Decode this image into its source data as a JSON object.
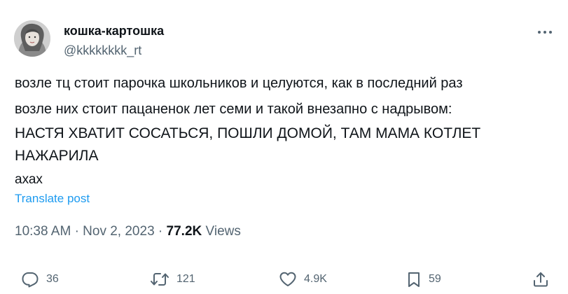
{
  "author": {
    "display_name": "кошка-картошка",
    "handle": "@kkkkkkkk_rt"
  },
  "post": {
    "lines": [
      "возле тц стоит парочка школьников и целуются, как в последний раз",
      "возле них стоит пацаненок лет семи и такой внезапно с надрывом:",
      "НАСТЯ ХВАТИТ СОСАТЬСЯ, ПОШЛИ ДОМОЙ, ТАМ МАМА КОТЛЕТ",
      "НАЖАРИЛА",
      "ахах"
    ],
    "translate_label": "Translate post"
  },
  "meta": {
    "time": "10:38 AM",
    "separator": "·",
    "date": "Nov 2, 2023",
    "views_count": "77.2K",
    "views_label": "Views"
  },
  "actions": {
    "replies": "36",
    "reposts": "121",
    "likes": "4.9K",
    "bookmarks": "59"
  },
  "icons": [
    "more-icon",
    "reply-icon",
    "repost-icon",
    "like-icon",
    "bookmark-icon",
    "share-icon"
  ],
  "colors": {
    "text": "#0f1419",
    "secondary": "#536471",
    "link": "#1d9bf0"
  }
}
